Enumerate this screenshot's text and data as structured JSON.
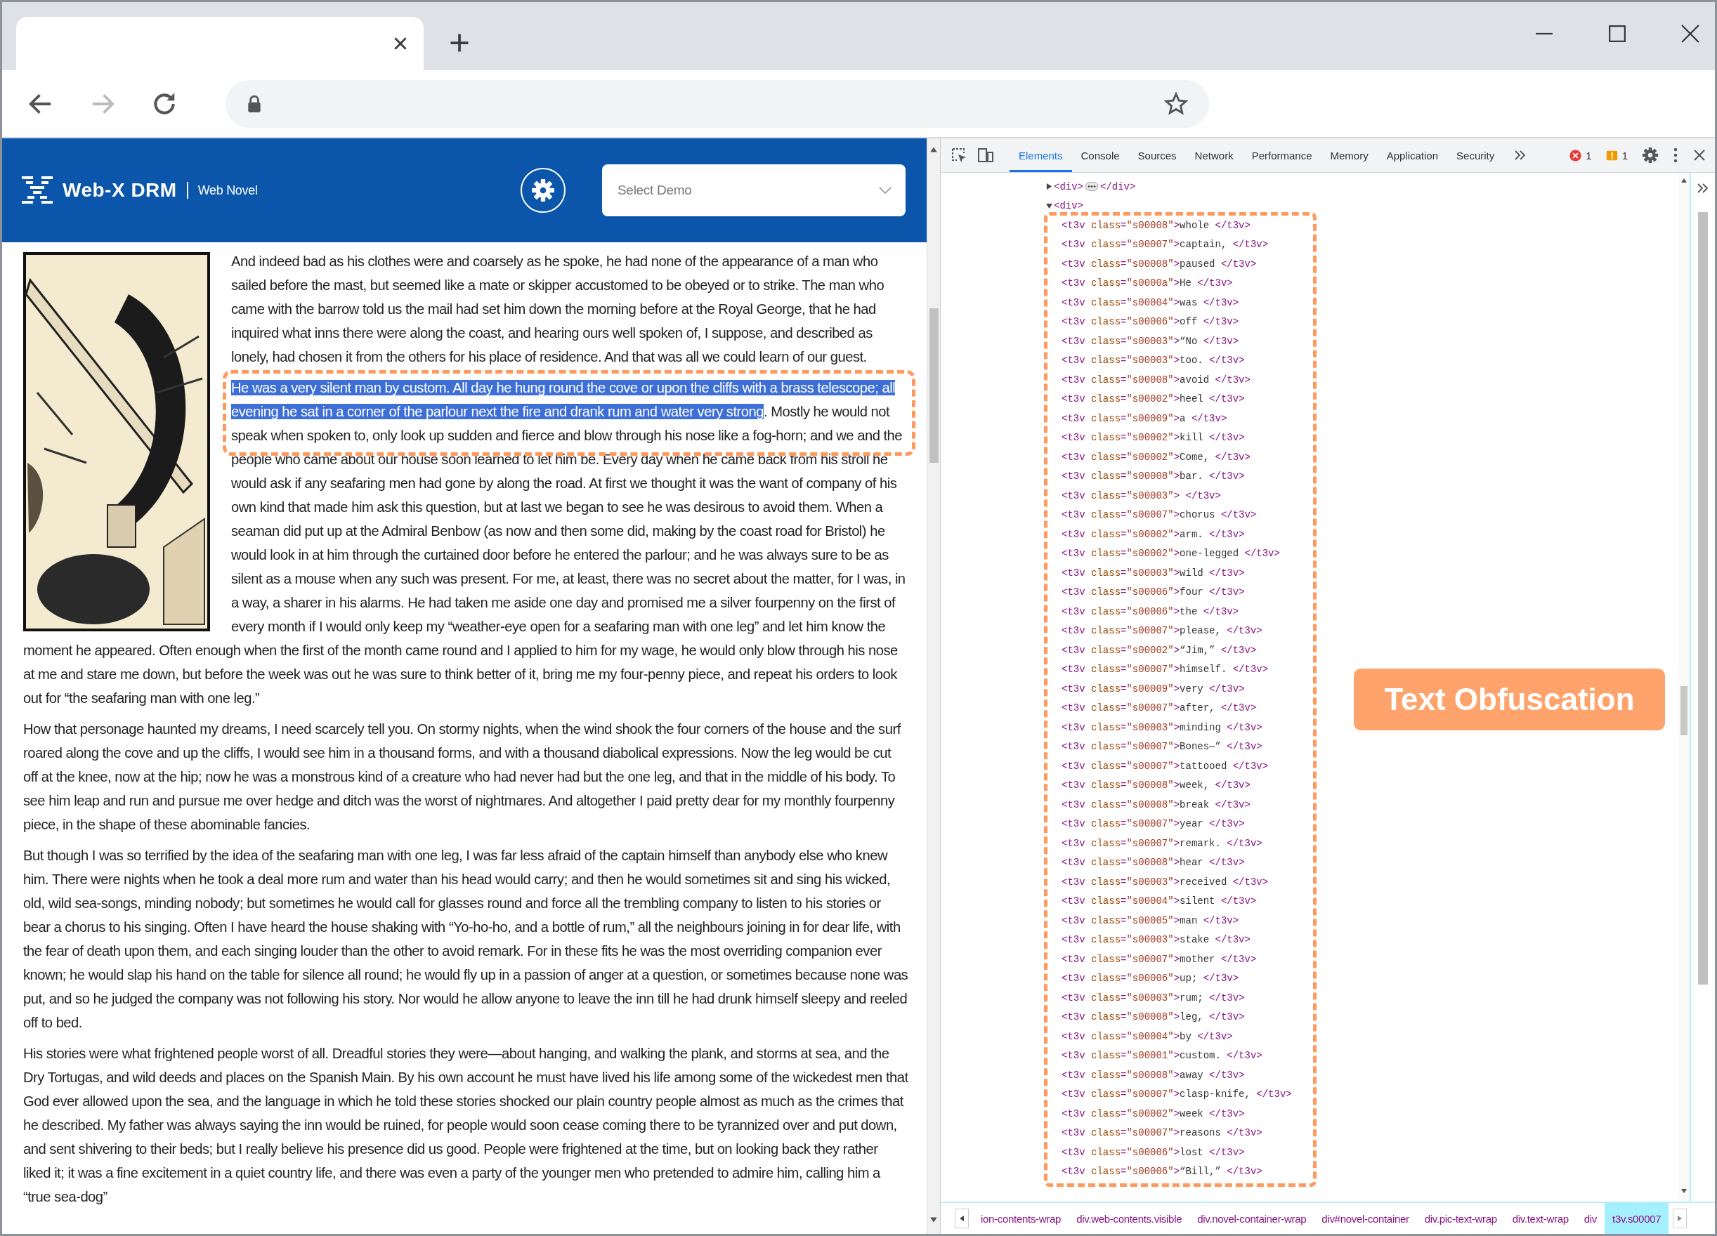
{
  "browser": {
    "tabs": [
      {
        "selected": true
      }
    ],
    "back": {
      "disabled": false
    },
    "forward": {
      "disabled": true
    }
  },
  "app": {
    "brand": "Web-X DRM",
    "section": "Web Novel",
    "select": {
      "placeholder": "Select Demo"
    }
  },
  "novel": {
    "paragraphs": [
      {
        "framed": false,
        "segments": [
          {
            "text": "And indeed bad as his clothes were and coarsely as he spoke, he had none of the appearance of a man who sailed before the mast, but seemed like a mate or skipper accustomed to be obeyed or to strike. The man who came with the barrow told us the mail had set him down the morning before at the Royal George, that he had inquired what inns there were along the coast, and hearing ours well spoken of, I suppose, and described as lonely, had chosen it from the others for his place of residence. And that was all we could learn of our guest.",
            "selected": false
          }
        ]
      },
      {
        "framed": true,
        "segments": [
          {
            "text": "He was a very silent man by custom. All day he hung round the cove or upon the cliffs with a brass telescope; all evening he sat in a corner of the parlour next the fire and drank rum and water very strong",
            "selected": true
          },
          {
            "text": ". Mostly he would not speak when spoken to, only look up sudden and fierce and blow through his nose like a fog-horn; and we and the people who came about our house soon learned to let him be. Every day when he came back from his stroll he would ask if any seafaring men had gone by along the road. At first we thought it was the want of company of his own kind that made him ask this question, but at last we began to see he was desirous to avoid them. When a seaman did put up at the Admiral Benbow (as now and then some did, making by the coast road for Bristol) he would look in at him through the curtained door before he entered the parlour; and he was always sure to be as silent as a mouse when any such was present. For me, at least, there was no secret about the matter, for I was, in a way, a sharer in his alarms. He had taken me aside one day and promised me a silver fourpenny on the first of every month if I would only keep my “weather-eye open for a seafaring man with one leg” and let him know the moment he appeared. Often enough when the first of the month came round and I applied to him for my wage, he would only blow through his nose at me and stare me down, but before the week was out he was sure to think better of it, bring me my four-penny piece, and repeat his orders to look out for “the seafaring man with one leg.”",
            "selected": false
          }
        ]
      },
      {
        "framed": false,
        "segments": [
          {
            "text": "How that personage haunted my dreams, I need scarcely tell you. On stormy nights, when the wind shook the four corners of the house and the surf roared along the cove and up the cliffs, I would see him in a thousand forms, and with a thousand diabolical expressions. Now the leg would be cut off at the knee, now at the hip; now he was a monstrous kind of a creature who had never had but the one leg, and that in the middle of his body. To see him leap and run and pursue me over hedge and ditch was the worst of nightmares. And altogether I paid pretty dear for my monthly fourpenny piece, in the shape of these abominable fancies.",
            "selected": false
          }
        ]
      },
      {
        "framed": false,
        "segments": [
          {
            "text": "But though I was so terrified by the idea of the seafaring man with one leg, I was far less afraid of the captain himself than anybody else who knew him. There were nights when he took a deal more rum and water than his head would carry; and then he would sometimes sit and sing his wicked, old, wild sea-songs, minding nobody; but sometimes he would call for glasses round and force all the trembling company to listen to his stories or bear a chorus to his singing. Often I have heard the house shaking with “Yo-ho-ho, and a bottle of rum,” all the neighbours joining in for dear life, with the fear of death upon them, and each singing louder than the other to avoid remark. For in these fits he was the most overriding companion ever known; he would slap his hand on the table for silence all round; he would fly up in a passion of anger at a question, or sometimes because none was put, and so he judged the company was not following his story. Nor would he allow anyone to leave the inn till he had drunk himself sleepy and reeled off to bed.",
            "selected": false
          }
        ]
      },
      {
        "framed": false,
        "segments": [
          {
            "text": "His stories were what frightened people worst of all. Dreadful stories they were—about hanging, and walking the plank, and storms at sea, and the Dry Tortugas, and wild deeds and places on the Spanish Main. By his own account he must have lived his life among some of the wickedest men that God ever allowed upon the sea, and the language in which he told these stories shocked our plain country people almost as much as the crimes that he described. My father was always saying the inn would be ruined, for people would soon cease coming there to be tyrannized over and put down, and sent shivering to their beds; but I really believe his presence did us good. People were frightened at the time, but on looking back they rather liked it; it was a fine excitement in a quiet country life, and there was even a party of the younger men who pretended to admire him, calling him a “true sea-dog”",
            "selected": false
          }
        ]
      }
    ]
  },
  "devtools": {
    "tabs": [
      {
        "label": "Elements",
        "selected": true
      },
      {
        "label": "Console",
        "selected": false
      },
      {
        "label": "Sources",
        "selected": false
      },
      {
        "label": "Network",
        "selected": false
      },
      {
        "label": "Performance",
        "selected": false
      },
      {
        "label": "Memory",
        "selected": false
      },
      {
        "label": "Application",
        "selected": false
      },
      {
        "label": "Security",
        "selected": false
      }
    ],
    "errors": "1",
    "warnings": "1",
    "dom_tree": [
      {
        "open_tag": "<div>",
        "close_tag": "</div>",
        "expanded": false
      },
      {
        "open_tag": "<div>",
        "expanded": true,
        "framed": true,
        "children": [
          {
            "markup": "<t3v class=\"s00008\">whole </t3v>"
          },
          {
            "markup": "<t3v class=\"s00007\">captain, </t3v>"
          },
          {
            "markup": "<t3v class=\"s00008\">paused </t3v>"
          },
          {
            "markup": "<t3v class=\"s0000a\">He </t3v>"
          },
          {
            "markup": "<t3v class=\"s00004\">was </t3v>"
          },
          {
            "markup": "<t3v class=\"s00006\">off </t3v>"
          },
          {
            "markup": "<t3v class=\"s00003\">“No </t3v>"
          },
          {
            "markup": "<t3v class=\"s00003\">too. </t3v>"
          },
          {
            "markup": "<t3v class=\"s00008\">avoid </t3v>"
          },
          {
            "markup": "<t3v class=\"s00002\">heel </t3v>"
          },
          {
            "markup": "<t3v class=\"s00009\">a </t3v>"
          },
          {
            "markup": "<t3v class=\"s00002\">kill </t3v>"
          },
          {
            "markup": "<t3v class=\"s00002\">Come, </t3v>"
          },
          {
            "markup": "<t3v class=\"s00008\">bar. </t3v>"
          },
          {
            "markup": "<t3v class=\"s00003\"> </t3v>"
          },
          {
            "markup": "<t3v class=\"s00007\">chorus </t3v>"
          },
          {
            "markup": "<t3v class=\"s00002\">arm. </t3v>"
          },
          {
            "markup": "<t3v class=\"s00002\">one-legged </t3v>"
          },
          {
            "markup": "<t3v class=\"s00003\">wild </t3v>"
          },
          {
            "markup": "<t3v class=\"s00006\">four </t3v>"
          },
          {
            "markup": "<t3v class=\"s00006\">the </t3v>"
          },
          {
            "markup": "<t3v class=\"s00007\">please, </t3v>"
          },
          {
            "markup": "<t3v class=\"s00002\">“Jim,” </t3v>"
          },
          {
            "markup": "<t3v class=\"s00007\">himself. </t3v>"
          },
          {
            "markup": "<t3v class=\"s00009\">very </t3v>"
          },
          {
            "markup": "<t3v class=\"s00007\">after, </t3v>"
          },
          {
            "markup": "<t3v class=\"s00003\">minding </t3v>"
          },
          {
            "markup": "<t3v class=\"s00007\">Bones—” </t3v>"
          },
          {
            "markup": "<t3v class=\"s00007\">tattooed </t3v>"
          },
          {
            "markup": "<t3v class=\"s00008\">week, </t3v>"
          },
          {
            "markup": "<t3v class=\"s00008\">break </t3v>"
          },
          {
            "markup": "<t3v class=\"s00007\">year </t3v>"
          },
          {
            "markup": "<t3v class=\"s00007\">remark. </t3v>"
          },
          {
            "markup": "<t3v class=\"s00008\">hear </t3v>"
          },
          {
            "markup": "<t3v class=\"s00003\">received </t3v>"
          },
          {
            "markup": "<t3v class=\"s00004\">silent </t3v>"
          },
          {
            "markup": "<t3v class=\"s00005\">man </t3v>"
          },
          {
            "markup": "<t3v class=\"s00003\">stake </t3v>"
          },
          {
            "markup": "<t3v class=\"s00007\">mother </t3v>"
          },
          {
            "markup": "<t3v class=\"s00006\">up; </t3v>"
          },
          {
            "markup": "<t3v class=\"s00003\">rum; </t3v>"
          },
          {
            "markup": "<t3v class=\"s00008\">leg, </t3v>"
          },
          {
            "markup": "<t3v class=\"s00004\">by </t3v>"
          },
          {
            "markup": "<t3v class=\"s00001\">custom. </t3v>"
          },
          {
            "markup": "<t3v class=\"s00008\">away </t3v>"
          },
          {
            "markup": "<t3v class=\"s00007\">clasp-knife, </t3v>"
          },
          {
            "markup": "<t3v class=\"s00002\">week </t3v>"
          },
          {
            "markup": "<t3v class=\"s00007\">reasons </t3v>"
          },
          {
            "markup": "<t3v class=\"s00006\">lost </t3v>"
          },
          {
            "markup": "<t3v class=\"s00006\">“Bill,” </t3v>"
          }
        ]
      }
    ],
    "breadcrumbs": [
      {
        "label": "ion-contents-wrap",
        "selected": false
      },
      {
        "label": "div.web-contents.visible",
        "selected": false
      },
      {
        "label": "div.novel-container-wrap",
        "selected": false
      },
      {
        "label": "div#novel-container",
        "selected": false
      },
      {
        "label": "div.pic-text-wrap",
        "selected": false
      },
      {
        "label": "div.text-wrap",
        "selected": false
      },
      {
        "label": "div",
        "selected": false
      },
      {
        "label": "t3v.s00007",
        "selected": true
      }
    ],
    "annotation": {
      "label": "Text Obfuscation"
    }
  }
}
